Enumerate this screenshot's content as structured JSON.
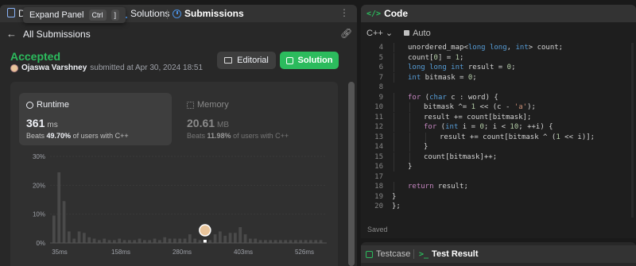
{
  "left_tabs": {
    "description_short": "D",
    "tooltip": {
      "label": "Expand Panel",
      "key1": "Ctrl",
      "key2": "]"
    },
    "solutions_label": "Solutions",
    "submissions_label": "Submissions"
  },
  "back_label": "All Submissions",
  "submission": {
    "status": "Accepted",
    "user": "Ojaswa Varshney",
    "submitted_text": "submitted at Apr 30, 2024 18:51"
  },
  "buttons": {
    "editorial": "Editorial",
    "solution": "Solution"
  },
  "runtime": {
    "title": "Runtime",
    "value": "361",
    "unit": "ms",
    "beats_prefix": "Beats",
    "beats_pct": "49.70%",
    "beats_suffix": "of users with C++"
  },
  "memory": {
    "title": "Memory",
    "value": "20.61",
    "unit": "MB",
    "beats_prefix": "Beats",
    "beats_pct": "11.98%",
    "beats_suffix": "of users with C++"
  },
  "chart_data": {
    "type": "bar",
    "y_ticks": [
      "30%",
      "20%",
      "10%",
      "0%"
    ],
    "ylim": [
      0,
      30
    ],
    "x_ticks": [
      "35ms",
      "158ms",
      "280ms",
      "403ms",
      "526ms"
    ],
    "values": [
      9.5,
      24.5,
      14.5,
      4,
      1.5,
      4,
      3.5,
      2,
      1.5,
      1,
      1.5,
      1,
      1,
      1.5,
      1,
      1,
      1,
      1.5,
      1,
      1,
      1.5,
      1,
      2,
      1.5,
      1.5,
      1.5,
      1.5,
      3,
      1.5,
      1,
      1,
      1,
      3,
      4,
      2.5,
      3.5,
      3.5,
      5.5,
      3,
      1.5,
      1.5,
      1,
      1,
      1,
      1,
      1,
      1,
      1,
      1,
      1,
      1,
      1,
      1,
      1
    ],
    "highlight_index": 30
  },
  "code_panel": {
    "title": "Code",
    "language": "C++",
    "mode": "Auto",
    "saved": "Saved"
  },
  "code_lines": [
    {
      "n": "4",
      "indent": 2,
      "html": "unordered_map&lt;<span class=\"kw\">long long</span>, <span class=\"kw\">int</span>&gt; count;"
    },
    {
      "n": "5",
      "indent": 2,
      "html": "count[<span class=\"num\">0</span>] = <span class=\"num\">1</span>;"
    },
    {
      "n": "6",
      "indent": 2,
      "html": "<span class=\"kw\">long long int</span> result = <span class=\"num\">0</span>;"
    },
    {
      "n": "7",
      "indent": 2,
      "html": "<span class=\"kw\">int</span> bitmask = <span class=\"num\">0</span>;"
    },
    {
      "n": "8",
      "indent": 0,
      "html": ""
    },
    {
      "n": "9",
      "indent": 2,
      "html": "<span class=\"ctl\">for</span> (<span class=\"kw\">char</span> c : word) {"
    },
    {
      "n": "10",
      "indent": 3,
      "html": "bitmask ^= <span class=\"num\">1</span> &lt;&lt; (c - <span style=\"color:#ce9178\">'a'</span>);"
    },
    {
      "n": "11",
      "indent": 3,
      "html": "result += count[bitmask];"
    },
    {
      "n": "12",
      "indent": 3,
      "html": "<span class=\"ctl\">for</span> (<span class=\"kw\">int</span> i = <span class=\"num\">0</span>; i &lt; <span class=\"num\">10</span>; ++i) {"
    },
    {
      "n": "13",
      "indent": 4,
      "html": "result += count[bitmask ^ (<span class=\"num\">1</span> &lt;&lt; i)];"
    },
    {
      "n": "14",
      "indent": 3,
      "html": "}"
    },
    {
      "n": "15",
      "indent": 3,
      "html": "count[bitmask]++;"
    },
    {
      "n": "16",
      "indent": 2,
      "html": "}"
    },
    {
      "n": "17",
      "indent": 0,
      "html": ""
    },
    {
      "n": "18",
      "indent": 2,
      "html": "<span class=\"ctl\">return</span> result;"
    },
    {
      "n": "19",
      "indent": 1,
      "html": "}"
    },
    {
      "n": "20",
      "indent": 0,
      "html": "};"
    }
  ],
  "bottom_tabs": {
    "testcase": "Testcase",
    "test_result": "Test Result"
  }
}
